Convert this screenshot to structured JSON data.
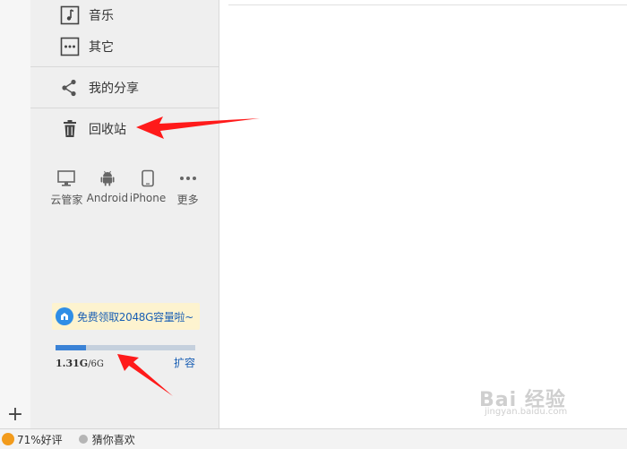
{
  "sidebar": {
    "items": [
      {
        "label": "音乐",
        "icon": "music-icon"
      },
      {
        "label": "其它",
        "icon": "more-box-icon"
      },
      {
        "label": "我的分享",
        "icon": "share-icon"
      },
      {
        "label": "回收站",
        "icon": "trash-icon"
      }
    ],
    "devices": [
      {
        "label": "云管家",
        "icon": "monitor-icon"
      },
      {
        "label": "Android",
        "icon": "android-icon"
      },
      {
        "label": "iPhone",
        "icon": "phone-icon"
      },
      {
        "label": "更多",
        "icon": "more-dots-icon"
      }
    ],
    "promo": {
      "text": "免费领取2048G容量啦~",
      "icon": "gift-badge-icon"
    },
    "quota": {
      "used": "1.31G",
      "total": "/6G",
      "used_fraction": 0.22,
      "expand_label": "扩容"
    }
  },
  "statusbar": {
    "rating": "71%好评",
    "guess": "猜你喜欢"
  },
  "left_strip": {
    "add_icon": "plus-icon",
    "add_glyph": "+"
  },
  "colors": {
    "annotation_arrow": "#ff1a1a",
    "accent": "#3b82d6",
    "link": "#1a5fb4"
  },
  "watermark": {
    "main": "Bai 经验",
    "sub": "jingyan.baidu.com"
  }
}
